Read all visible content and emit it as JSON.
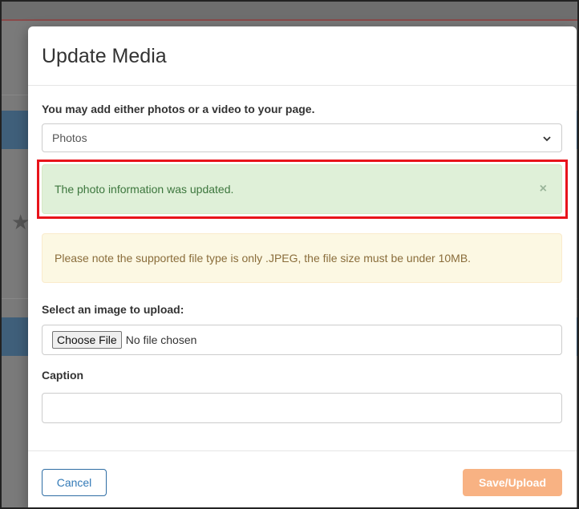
{
  "modal": {
    "title": "Update Media",
    "intro": "You may add either photos or a video to your page.",
    "media_select": {
      "selected": "Photos"
    },
    "alerts": {
      "success": "The photo information was updated.",
      "success_close": "×",
      "warning": "Please note the supported file type is only .JPEG, the file size must be under 10MB."
    },
    "upload": {
      "label": "Select an image to upload:",
      "button": "Choose File",
      "status": "No file chosen"
    },
    "caption": {
      "label": "Caption",
      "value": ""
    },
    "footer": {
      "cancel": "Cancel",
      "save": "Save/Upload"
    }
  },
  "colors": {
    "success_bg": "#dff0d8",
    "warning_bg": "#fcf8e3",
    "highlight": "#e8141b",
    "save_button": "#f8b283",
    "cancel_border": "#2e6da4"
  },
  "icons": {
    "select_caret": "chevron-down-icon",
    "alert_close": "close-icon"
  }
}
